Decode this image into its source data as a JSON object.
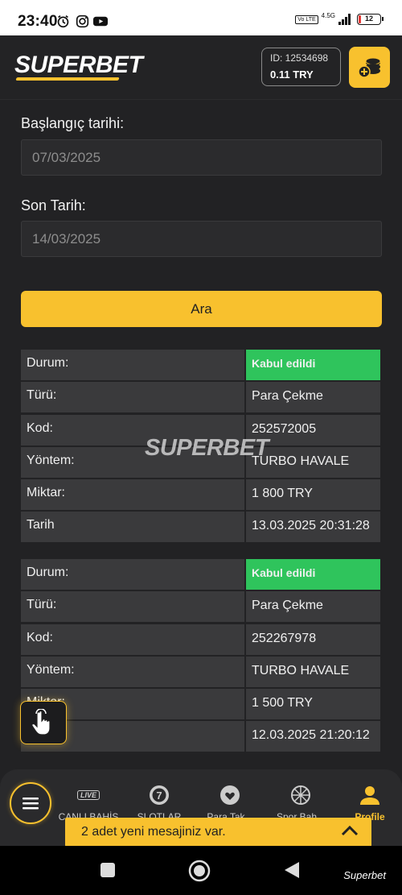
{
  "status_bar": {
    "time": "23:40",
    "network": "4.5G",
    "volte": "Vo LTE",
    "battery": "12"
  },
  "header": {
    "logo_text": "SUPERBET",
    "account_id": "ID: 12534698",
    "balance": "0.11 TRY",
    "deposit_icon": "coins-plus-icon"
  },
  "form": {
    "start_label": "Başlangıç tarihi:",
    "start_value": "07/03/2025",
    "end_label": "Son Tarih:",
    "end_value": "14/03/2025",
    "search_button": "Ara"
  },
  "transactions": [
    {
      "rows": [
        {
          "key": "Durum:",
          "value": "Kabul edildi"
        },
        {
          "key": "Türü:",
          "value": "Para Çekme"
        },
        {
          "key": "Kod:",
          "value": "252572005"
        },
        {
          "key": "Yöntem:",
          "value": "TURBO HAVALE"
        },
        {
          "key": "Miktar:",
          "value": "1 800 TRY"
        },
        {
          "key": "Tarih",
          "value": "13.03.2025 20:31:28"
        }
      ]
    },
    {
      "rows": [
        {
          "key": "Durum:",
          "value": "Kabul edildi"
        },
        {
          "key": "Türü:",
          "value": "Para Çekme"
        },
        {
          "key": "Kod:",
          "value": "252267978"
        },
        {
          "key": "Yöntem:",
          "value": "TURBO HAVALE"
        },
        {
          "key": "Miktar:",
          "value": "1 500 TRY"
        },
        {
          "key": "",
          "value": "12.03.2025 21:20:12"
        }
      ]
    }
  ],
  "watermark": "SUPERBET",
  "bottom_nav": {
    "items": [
      {
        "label": "CANLI BAHİS",
        "icon": "live-icon"
      },
      {
        "label": "SLOTLAR",
        "icon": "slot-7-icon"
      },
      {
        "label": "Para Tak...",
        "icon": "heart-icon"
      },
      {
        "label": "Spor Bah...",
        "icon": "ball-icon"
      },
      {
        "label": "Profile",
        "icon": "user-icon"
      }
    ],
    "live_badge": "LIVE"
  },
  "toast": {
    "message": "2 adet yeni mesajiniz var."
  },
  "system_nav": {
    "caption": "Superbet"
  },
  "colors": {
    "accent": "#f8c12e",
    "accepted": "#2fc45c",
    "background": "#222224",
    "cell": "#3a3a3c"
  }
}
